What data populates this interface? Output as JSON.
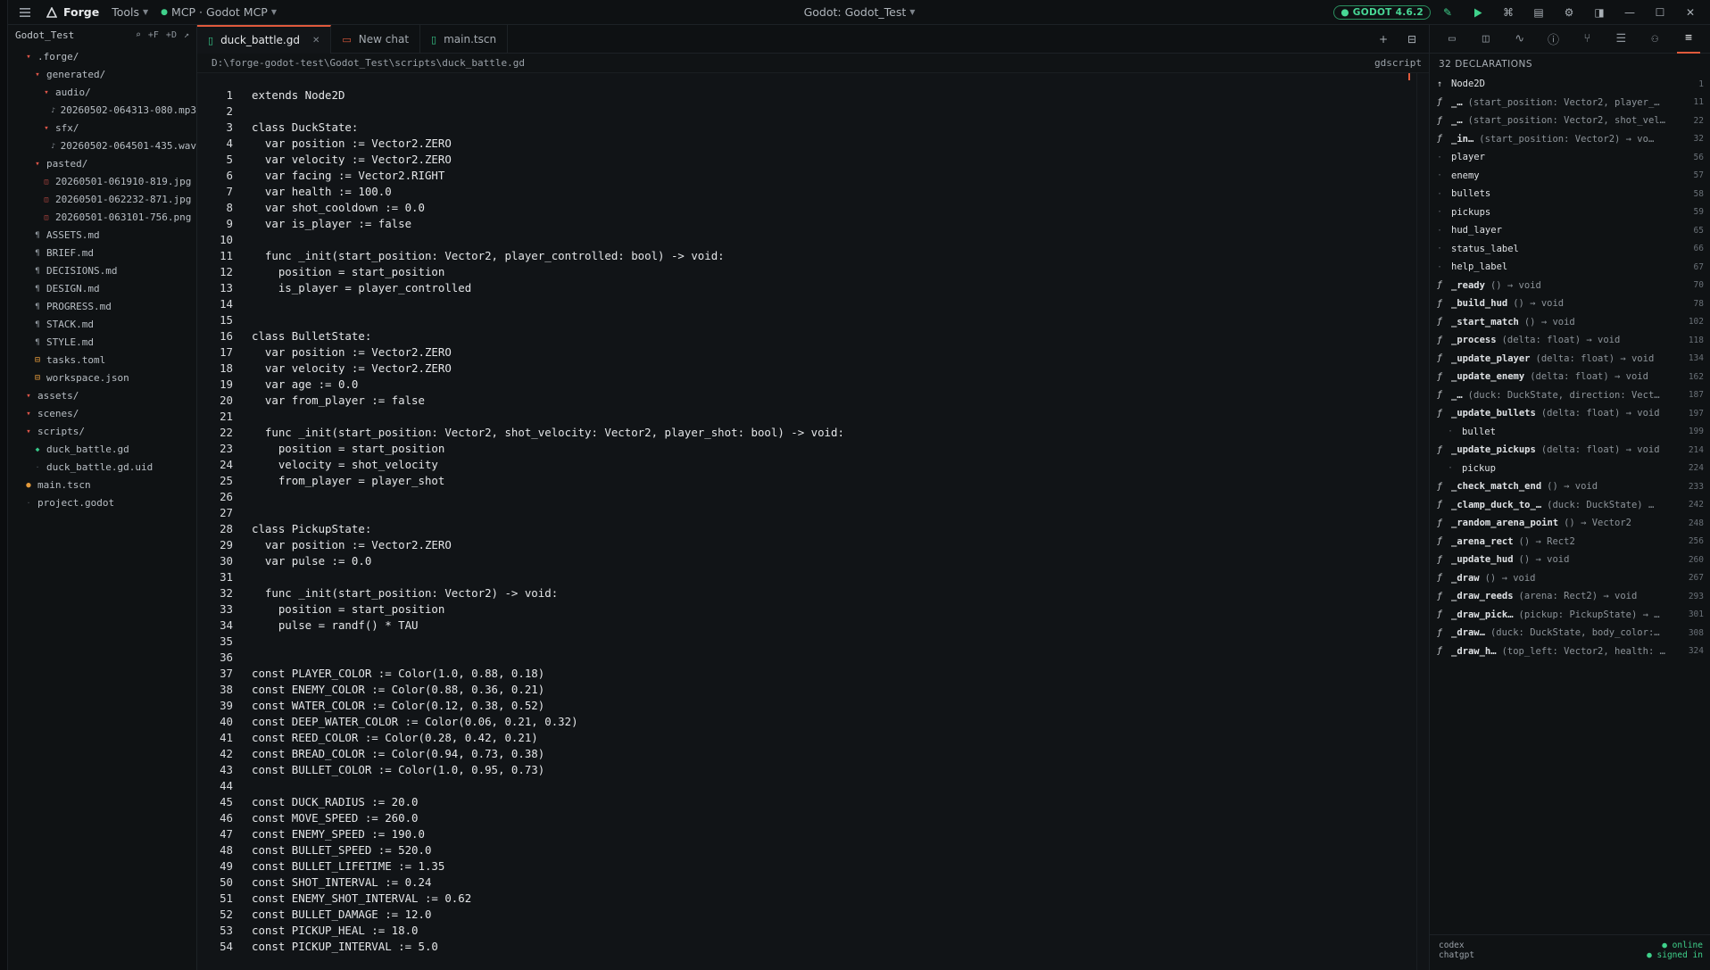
{
  "topbar": {
    "brand": "Forge",
    "tools_label": "Tools",
    "mcp_label": "MCP · Godot MCP",
    "center_title": "Godot: Godot_Test",
    "godot_badge": "GODOT 4.6.2",
    "accent_color": "#3fd18b"
  },
  "explorer": {
    "title": "Godot_Test",
    "actions": [
      "⌕",
      "+F",
      "+D",
      "↗"
    ],
    "items": [
      {
        "label": ".forge/",
        "depth": 1,
        "type": "folder"
      },
      {
        "label": "generated/",
        "depth": 2,
        "type": "folder"
      },
      {
        "label": "audio/",
        "depth": 3,
        "type": "folder"
      },
      {
        "label": "20260502-064313-080.mp3",
        "depth": 4,
        "type": "audio"
      },
      {
        "label": "sfx/",
        "depth": 3,
        "type": "folder"
      },
      {
        "label": "20260502-064501-435.wav",
        "depth": 4,
        "type": "audio"
      },
      {
        "label": "pasted/",
        "depth": 2,
        "type": "folder"
      },
      {
        "label": "20260501-061910-819.jpg",
        "depth": 3,
        "type": "img"
      },
      {
        "label": "20260501-062232-871.jpg",
        "depth": 3,
        "type": "img"
      },
      {
        "label": "20260501-063101-756.png",
        "depth": 3,
        "type": "img"
      },
      {
        "label": "ASSETS.md",
        "depth": 2,
        "type": "md"
      },
      {
        "label": "BRIEF.md",
        "depth": 2,
        "type": "md"
      },
      {
        "label": "DECISIONS.md",
        "depth": 2,
        "type": "md"
      },
      {
        "label": "DESIGN.md",
        "depth": 2,
        "type": "md"
      },
      {
        "label": "PROGRESS.md",
        "depth": 2,
        "type": "md"
      },
      {
        "label": "STACK.md",
        "depth": 2,
        "type": "md"
      },
      {
        "label": "STYLE.md",
        "depth": 2,
        "type": "md"
      },
      {
        "label": "tasks.toml",
        "depth": 2,
        "type": "cfg"
      },
      {
        "label": "workspace.json",
        "depth": 2,
        "type": "cfg"
      },
      {
        "label": "assets/",
        "depth": 1,
        "type": "folder"
      },
      {
        "label": "scenes/",
        "depth": 1,
        "type": "folder"
      },
      {
        "label": "scripts/",
        "depth": 1,
        "type": "folder"
      },
      {
        "label": "duck_battle.gd",
        "depth": 2,
        "type": "gd"
      },
      {
        "label": "duck_battle.gd.uid",
        "depth": 2,
        "type": "plain"
      },
      {
        "label": "main.tscn",
        "depth": 1,
        "type": "scene"
      },
      {
        "label": "project.godot",
        "depth": 1,
        "type": "plain"
      }
    ]
  },
  "tabs": [
    {
      "label": "duck_battle.gd",
      "icon": "gd",
      "active": true,
      "closable": true
    },
    {
      "label": "New chat",
      "icon": "chat",
      "active": false,
      "closable": false
    },
    {
      "label": "main.tscn",
      "icon": "gd",
      "active": false,
      "closable": false
    }
  ],
  "pathbar": {
    "path": "D:\\forge-godot-test\\Godot_Test\\scripts\\duck_battle.gd",
    "language": "gdscript"
  },
  "code": [
    "extends Node2D",
    "",
    "class DuckState:",
    "  var position := Vector2.ZERO",
    "  var velocity := Vector2.ZERO",
    "  var facing := Vector2.RIGHT",
    "  var health := 100.0",
    "  var shot_cooldown := 0.0",
    "  var is_player := false",
    "",
    "  func _init(start_position: Vector2, player_controlled: bool) -> void:",
    "    position = start_position",
    "    is_player = player_controlled",
    "",
    "",
    "class BulletState:",
    "  var position := Vector2.ZERO",
    "  var velocity := Vector2.ZERO",
    "  var age := 0.0",
    "  var from_player := false",
    "",
    "  func _init(start_position: Vector2, shot_velocity: Vector2, player_shot: bool) -> void:",
    "    position = start_position",
    "    velocity = shot_velocity",
    "    from_player = player_shot",
    "",
    "",
    "class PickupState:",
    "  var position := Vector2.ZERO",
    "  var pulse := 0.0",
    "",
    "  func _init(start_position: Vector2) -> void:",
    "    position = start_position",
    "    pulse = randf() * TAU",
    "",
    "",
    "const PLAYER_COLOR := Color(1.0, 0.88, 0.18)",
    "const ENEMY_COLOR := Color(0.88, 0.36, 0.21)",
    "const WATER_COLOR := Color(0.12, 0.38, 0.52)",
    "const DEEP_WATER_COLOR := Color(0.06, 0.21, 0.32)",
    "const REED_COLOR := Color(0.28, 0.42, 0.21)",
    "const BREAD_COLOR := Color(0.94, 0.73, 0.38)",
    "const BULLET_COLOR := Color(1.0, 0.95, 0.73)",
    "",
    "const DUCK_RADIUS := 20.0",
    "const MOVE_SPEED := 260.0",
    "const ENEMY_SPEED := 190.0",
    "const BULLET_SPEED := 520.0",
    "const BULLET_LIFETIME := 1.35",
    "const SHOT_INTERVAL := 0.24",
    "const ENEMY_SHOT_INTERVAL := 0.62",
    "const BULLET_DAMAGE := 12.0",
    "const PICKUP_HEAL := 18.0",
    "const PICKUP_INTERVAL := 5.0"
  ],
  "outline": {
    "header": "32 DECLARATIONS",
    "declarations": [
      {
        "kind": "up",
        "name": "Node2D",
        "sig": "",
        "line": "1"
      },
      {
        "kind": "fn",
        "name": "_…",
        "sig": "(start_position: Vector2, player_…",
        "line": "11"
      },
      {
        "kind": "fn",
        "name": "_…",
        "sig": "(start_position: Vector2, shot_vel…",
        "line": "22"
      },
      {
        "kind": "fn",
        "name": "_in…",
        "sig": "(start_position: Vector2) → vo…",
        "line": "32"
      },
      {
        "kind": "var",
        "name": "player",
        "sig": "",
        "line": "56"
      },
      {
        "kind": "var",
        "name": "enemy",
        "sig": "",
        "line": "57"
      },
      {
        "kind": "var",
        "name": "bullets",
        "sig": "",
        "line": "58"
      },
      {
        "kind": "var",
        "name": "pickups",
        "sig": "",
        "line": "59"
      },
      {
        "kind": "var",
        "name": "hud_layer",
        "sig": "",
        "line": "65"
      },
      {
        "kind": "var",
        "name": "status_label",
        "sig": "",
        "line": "66"
      },
      {
        "kind": "var",
        "name": "help_label",
        "sig": "",
        "line": "67"
      },
      {
        "kind": "fn",
        "name": "_ready",
        "sig": "() → void",
        "line": "70"
      },
      {
        "kind": "fn",
        "name": "_build_hud",
        "sig": "() → void",
        "line": "78"
      },
      {
        "kind": "fn",
        "name": "_start_match",
        "sig": "() → void",
        "line": "102"
      },
      {
        "kind": "fn",
        "name": "_process",
        "sig": "(delta: float) → void",
        "line": "118"
      },
      {
        "kind": "fn",
        "name": "_update_player",
        "sig": "(delta: float) → void",
        "line": "134"
      },
      {
        "kind": "fn",
        "name": "_update_enemy",
        "sig": "(delta: float) → void",
        "line": "162"
      },
      {
        "kind": "fn",
        "name": "_…",
        "sig": "(duck: DuckState, direction: Vect…",
        "line": "187"
      },
      {
        "kind": "fn",
        "name": "_update_bullets",
        "sig": "(delta: float) → void",
        "line": "197"
      },
      {
        "kind": "sub",
        "name": "bullet",
        "sig": "",
        "line": "199"
      },
      {
        "kind": "fn",
        "name": "_update_pickups",
        "sig": "(delta: float) → void",
        "line": "214"
      },
      {
        "kind": "sub",
        "name": "pickup",
        "sig": "",
        "line": "224"
      },
      {
        "kind": "fn",
        "name": "_check_match_end",
        "sig": "() → void",
        "line": "233"
      },
      {
        "kind": "fn",
        "name": "_clamp_duck_to_…",
        "sig": "(duck: DuckState) …",
        "line": "242"
      },
      {
        "kind": "fn",
        "name": "_random_arena_point",
        "sig": "() → Vector2",
        "line": "248"
      },
      {
        "kind": "fn",
        "name": "_arena_rect",
        "sig": "() → Rect2",
        "line": "256"
      },
      {
        "kind": "fn",
        "name": "_update_hud",
        "sig": "() → void",
        "line": "260"
      },
      {
        "kind": "fn",
        "name": "_draw",
        "sig": "() → void",
        "line": "267"
      },
      {
        "kind": "fn",
        "name": "_draw_reeds",
        "sig": "(arena: Rect2) → void",
        "line": "293"
      },
      {
        "kind": "fn",
        "name": "_draw_pick…",
        "sig": "(pickup: PickupState) → …",
        "line": "301"
      },
      {
        "kind": "fn",
        "name": "_draw…",
        "sig": "(duck: DuckState, body_color:…",
        "line": "308"
      },
      {
        "kind": "fn",
        "name": "_draw_h…",
        "sig": "(top_left: Vector2, health: …",
        "line": "324"
      }
    ],
    "footer": {
      "left1": "codex",
      "left2": "chatgpt",
      "right1": "● online",
      "right2": "● signed in"
    }
  }
}
